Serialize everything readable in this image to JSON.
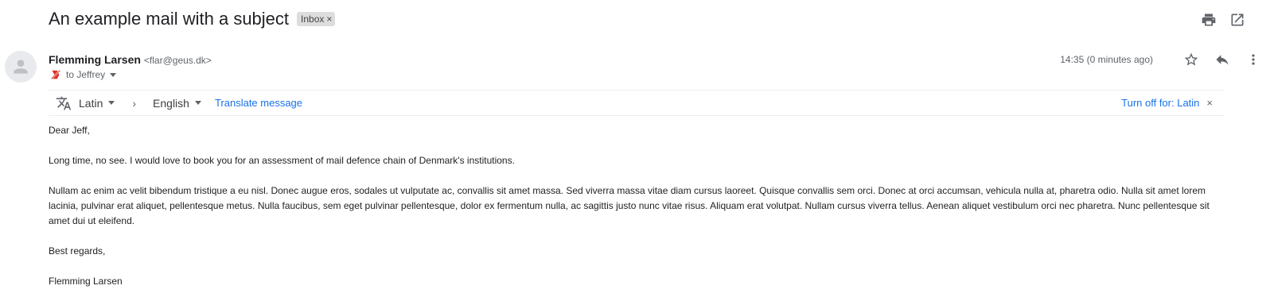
{
  "subject": "An example mail with a subject",
  "label": {
    "name": "Inbox",
    "remove_glyph": "×"
  },
  "top_actions": {
    "print_icon": "print-icon",
    "open_new_window_icon": "open-in-new-icon"
  },
  "sender": {
    "name": "Flemming Larsen",
    "email": "<flar@geus.dk>",
    "avatar_icon": "person-icon"
  },
  "recipients": {
    "text": "to Jeffrey",
    "importance_icon": "not-important-icon"
  },
  "meta": {
    "timestamp": "14:35 (0 minutes ago)",
    "star_icon": "star-icon",
    "reply_icon": "reply-icon",
    "more_icon": "more-vert-icon"
  },
  "translate": {
    "icon": "translate-icon",
    "source_lang": "Latin",
    "chevron": "›",
    "target_lang": "English",
    "action": "Translate message",
    "turn_off": "Turn off for: Latin",
    "close_glyph": "×"
  },
  "body": {
    "greeting": "Dear Jeff,",
    "p1": "Long time, no see. I would love to book you for an assessment of mail defence chain of Denmark's institutions.",
    "p2": "Nullam ac enim ac velit bibendum tristique a eu nisl. Donec augue eros, sodales ut vulputate ac, convallis sit amet massa. Sed viverra massa vitae diam cursus laoreet. Quisque convallis sem orci. Donec at orci accumsan, vehicula nulla at, pharetra odio. Nulla sit amet lorem lacinia, pulvinar erat aliquet, pellentesque metus. Nulla faucibus, sem eget pulvinar pellentesque, dolor ex fermentum nulla, ac sagittis justo nunc vitae risus. Aliquam erat volutpat. Nullam cursus viverra tellus. Aenean aliquet vestibulum orci nec pharetra. Nunc pellentesque sit amet dui ut eleifend.",
    "closing": "Best regards,",
    "signature": "Flemming Larsen"
  },
  "colors": {
    "link": "#1a73e8",
    "text": "#202124",
    "muted": "#5f6368",
    "chip": "#dddddd",
    "important_marker": "#d93025"
  }
}
